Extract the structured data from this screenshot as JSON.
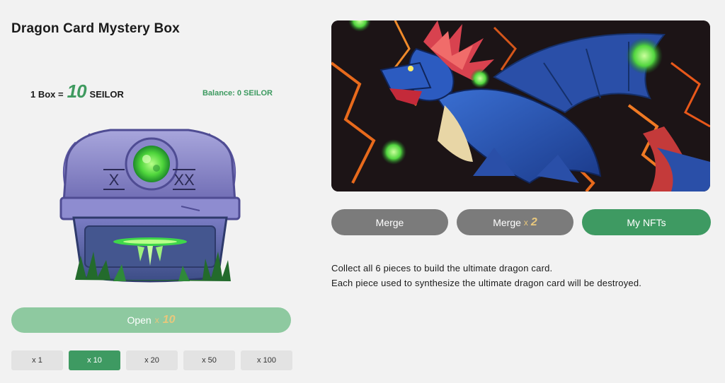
{
  "page": {
    "title": "Dragon Card Mystery Box"
  },
  "price": {
    "prefix": "1 Box =",
    "amount": "10",
    "currency": "SEILOR"
  },
  "balance": {
    "label": "Balance: 0 SEILOR"
  },
  "box": {
    "left_mark": "X",
    "right_mark": "XX"
  },
  "open_button": {
    "label": "Open",
    "multiplier": "x",
    "quantity": "10"
  },
  "quantity_options": [
    {
      "label": "x 1",
      "active": false
    },
    {
      "label": "x 10",
      "active": true
    },
    {
      "label": "x 20",
      "active": false
    },
    {
      "label": "x 50",
      "active": false
    },
    {
      "label": "x 100",
      "active": false
    }
  ],
  "actions": {
    "merge": "Merge",
    "merge_multi": {
      "label": "Merge",
      "multiplier": "x",
      "quantity": "2"
    },
    "my_nfts": "My NFTs"
  },
  "description": [
    "Collect all 6 pieces to build the ultimate dragon card.",
    "Each piece used to synthesize the ultimate dragon card will be destroyed."
  ],
  "colors": {
    "accent_green": "#3e9a62",
    "muted_green": "#8ec9a0",
    "gold": "#e8c77c",
    "gray_button": "#7b7b7b",
    "background": "#f2f2f2"
  }
}
